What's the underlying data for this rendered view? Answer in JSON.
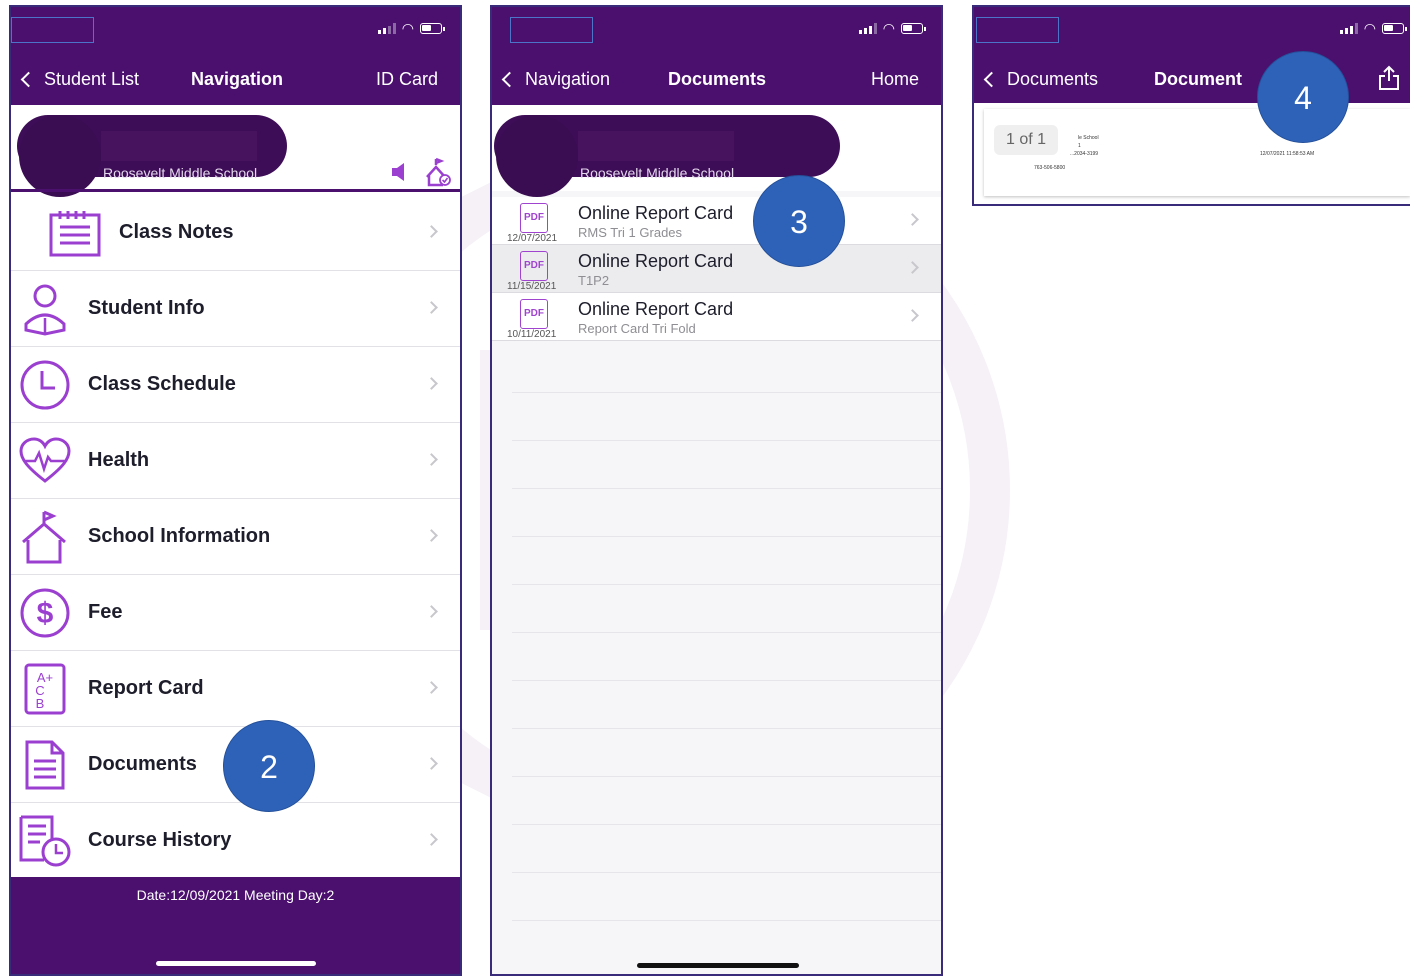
{
  "phone1": {
    "nav": {
      "back": "Student List",
      "title": "Navigation",
      "right": "ID Card"
    },
    "school": "Roosevelt Middle School",
    "menu": [
      {
        "label": "Class Notes",
        "icon": "notepad-icon"
      },
      {
        "label": "Student Info",
        "icon": "student-icon"
      },
      {
        "label": "Class Schedule",
        "icon": "clock-icon"
      },
      {
        "label": "Health",
        "icon": "heart-icon"
      },
      {
        "label": "School Information",
        "icon": "school-icon"
      },
      {
        "label": "Fee",
        "icon": "dollar-icon"
      },
      {
        "label": "Report Card",
        "icon": "grades-icon"
      },
      {
        "label": "Documents",
        "icon": "document-icon"
      },
      {
        "label": "Course History",
        "icon": "history-icon"
      }
    ],
    "footer": "Date:12/09/2021 Meeting Day:2",
    "step": "2"
  },
  "phone2": {
    "nav": {
      "back": "Navigation",
      "title": "Documents",
      "right": "Home"
    },
    "school": "Roosevelt Middle School",
    "docs": [
      {
        "icon_text": "PDF",
        "date": "12/07/2021",
        "title": "Online Report Card",
        "sub": "RMS Tri 1 Grades"
      },
      {
        "icon_text": "PDF",
        "date": "11/15/2021",
        "title": "Online Report Card",
        "sub": "T1P2"
      },
      {
        "icon_text": "PDF",
        "date": "10/11/2021",
        "title": "Online Report Card",
        "sub": "Report Card Tri Fold"
      }
    ],
    "step": "3"
  },
  "phone3": {
    "nav": {
      "back": "Documents",
      "title": "Document"
    },
    "page_count": "1 of 1",
    "tiny1": "le School",
    "tiny2": "1",
    "tiny3": "...2034-3199",
    "tiny4": "763-506-5800",
    "tiny5": "12/07/2021 11:58:53 AM",
    "step": "4"
  },
  "colors": {
    "brand": "#4b0f6e",
    "accent": "#9b3fd0",
    "badge": "#2e62b8"
  }
}
